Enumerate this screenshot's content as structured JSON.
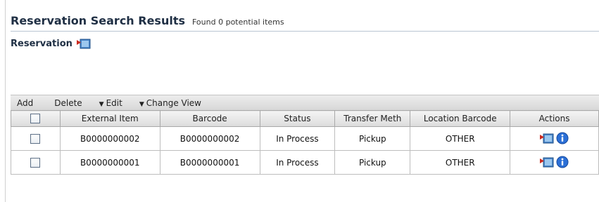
{
  "header": {
    "title": "Reservation Search Results",
    "subtitle": "Found 0 potential items"
  },
  "section": {
    "label": "Reservation",
    "icon": "export-icon"
  },
  "toolbar": {
    "add_label": "Add",
    "delete_label": "Delete",
    "edit_label": "Edit",
    "change_view_label": "Change View"
  },
  "table": {
    "columns": [
      "External Item",
      "Barcode",
      "Status",
      "Transfer Meth",
      "Location Barcode",
      "Actions"
    ],
    "rows": [
      {
        "external_item": "B0000000002",
        "barcode": "B0000000002",
        "status": "In Process",
        "transfer_method": "Pickup",
        "location_barcode": "OTHER",
        "actions": [
          "export-icon",
          "info-icon"
        ]
      },
      {
        "external_item": "B0000000001",
        "barcode": "B0000000001",
        "status": "In Process",
        "transfer_method": "Pickup",
        "location_barcode": "OTHER",
        "actions": [
          "export-icon",
          "info-icon"
        ]
      }
    ]
  },
  "colors": {
    "title": "#1f2f44",
    "info_blue": "#2b6fd6",
    "export_red": "#cc2a1f"
  }
}
